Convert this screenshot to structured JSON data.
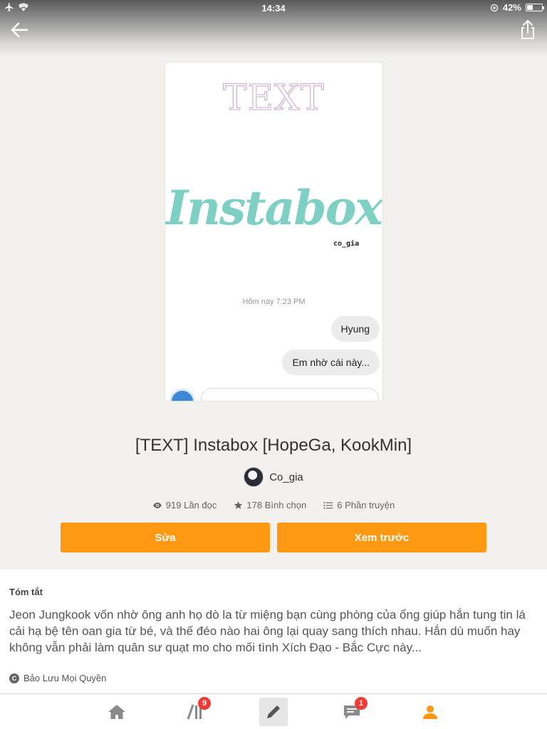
{
  "status_bar": {
    "time": "14:34",
    "battery": "42%",
    "battery_level": 0.42
  },
  "header": {
    "back_icon": "arrow-left-icon",
    "share_icon": "share-icon"
  },
  "cover": {
    "title_text": "TEXT",
    "brand_text": "Instabox",
    "author_tag": "co_gia",
    "timestamp": "Hôm nay 7:23 PM",
    "messages": [
      "Hyung",
      "Em nhờ cái này..."
    ]
  },
  "story": {
    "title": "[TEXT] Instabox [HopeGa, KookMin]",
    "author": "Co_gia",
    "reads": "919 Lần đọc",
    "votes": "178 Bình chọn",
    "parts": "6 Phần truyện"
  },
  "actions": {
    "edit_label": "Sửa",
    "preview_label": "Xem trước"
  },
  "summary": {
    "heading": "Tóm tắt",
    "text": "Jeon Jungkook vốn nhờ ông anh họ dò la từ miệng bạn cùng phòng của ổng giúp hắn tung tin lá cải hạ bệ tên oan gia từ bé, và thế đéo nào hai ông lại quay sang thích nhau. Hắn dù muốn hay không vẫn phải làm quân sư quạt mo cho mối tình Xích Đạo - Bắc Cực này...",
    "copyright": "Bảo Lưu Mọi Quyền"
  },
  "nav": {
    "library_badge": "9",
    "messages_badge": "1",
    "accent_color": "#ff9913",
    "badge_color": "#ef3b35"
  }
}
